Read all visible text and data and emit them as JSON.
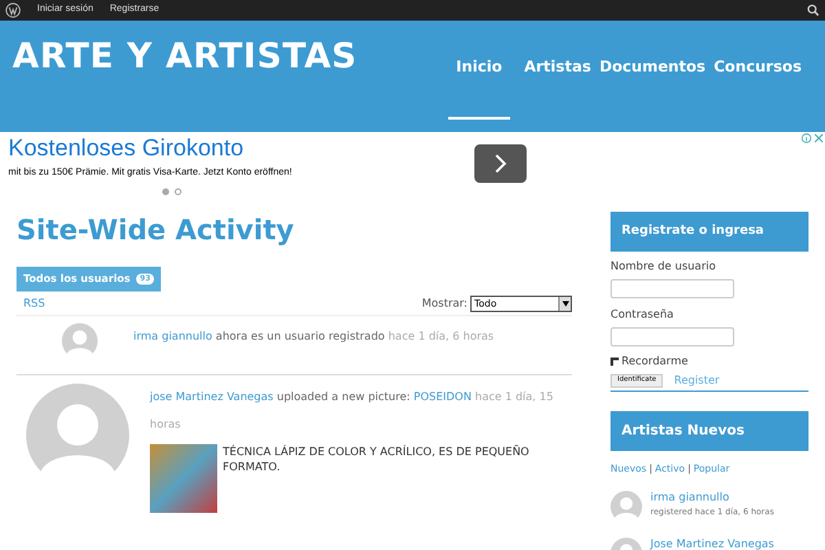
{
  "admin_bar": {
    "links": [
      "Iniciar sesión",
      "Registrarse"
    ]
  },
  "header": {
    "site_title": "ARTE Y ARTISTAS",
    "nav": [
      {
        "label": "Inicio",
        "selected": true
      },
      {
        "label": "Artistas",
        "selected": false
      },
      {
        "label": "Documentos",
        "selected": false
      },
      {
        "label": "Concursos",
        "selected": false
      }
    ]
  },
  "ad": {
    "headline": "Kostenloses Girokonto",
    "text": "mit bis zu 150€ Prämie. Mit gratis Visa-Karte. Jetzt Konto eröffnen!",
    "dots": [
      {
        "selected": true
      },
      {
        "selected": false
      }
    ]
  },
  "main": {
    "title": "Site-Wide Activity",
    "tab": {
      "label": "Todos los usuarios",
      "count": "93"
    },
    "rss": "RSS",
    "filter": {
      "label": "Mostrar:",
      "value": "Todo"
    },
    "activity": [
      {
        "kind": "small",
        "user": "irma giannullo",
        "action": " ahora es un usuario registrado",
        "time": "hace 1 día, 6 horas"
      },
      {
        "kind": "large",
        "user": "jose Martinez Vanegas",
        "action": " uploaded a new picture: ",
        "link": "POSEIDON",
        "time": "hace 1 día, 15 horas",
        "caption": "TÉCNICA LÁPIZ DE COLOR Y ACRÍLICO, ES DE PEQUEÑO FORMATO."
      }
    ]
  },
  "sidebar": {
    "login": {
      "title": "Registrate o ingresa",
      "username_label": "Nombre de usuario",
      "password_label": "Contraseña",
      "remember": {
        "label": "Recordarme",
        "checked": false
      },
      "submit": "Identificate",
      "register": "Register"
    },
    "new_artists": {
      "title": "Artistas Nuevos",
      "separator": "|",
      "filters": [
        {
          "label": "Nuevos",
          "selected": false
        },
        {
          "label": "Activo",
          "selected": false
        },
        {
          "label": "Popular",
          "selected": false
        }
      ],
      "items": [
        {
          "name": "irma giannullo",
          "meta": "registered hace 1 día, 6 horas"
        },
        {
          "name": "Jose Martinez Vanegas"
        }
      ]
    }
  }
}
